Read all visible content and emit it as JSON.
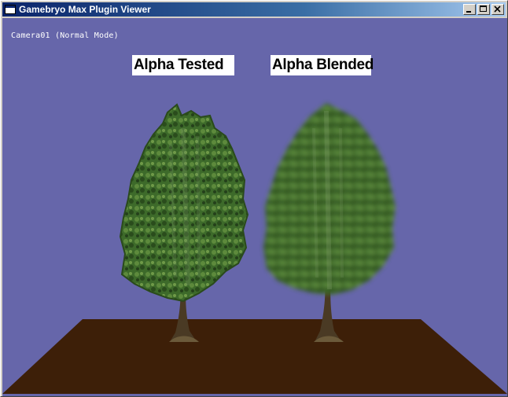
{
  "window": {
    "title": "Gamebryo Max Plugin Viewer",
    "controls": {
      "minimize_icon": "minimize-icon",
      "maximize_icon": "maximize-icon",
      "close_icon": "close-icon"
    }
  },
  "viewport": {
    "camera_label": "Camera01 (Normal Mode)",
    "signs": [
      "Alpha Tested",
      "Alpha Blended"
    ],
    "background_color": "#6666aa",
    "ground_color": "#3d1f08",
    "foliage_color": "#3c6a28"
  }
}
